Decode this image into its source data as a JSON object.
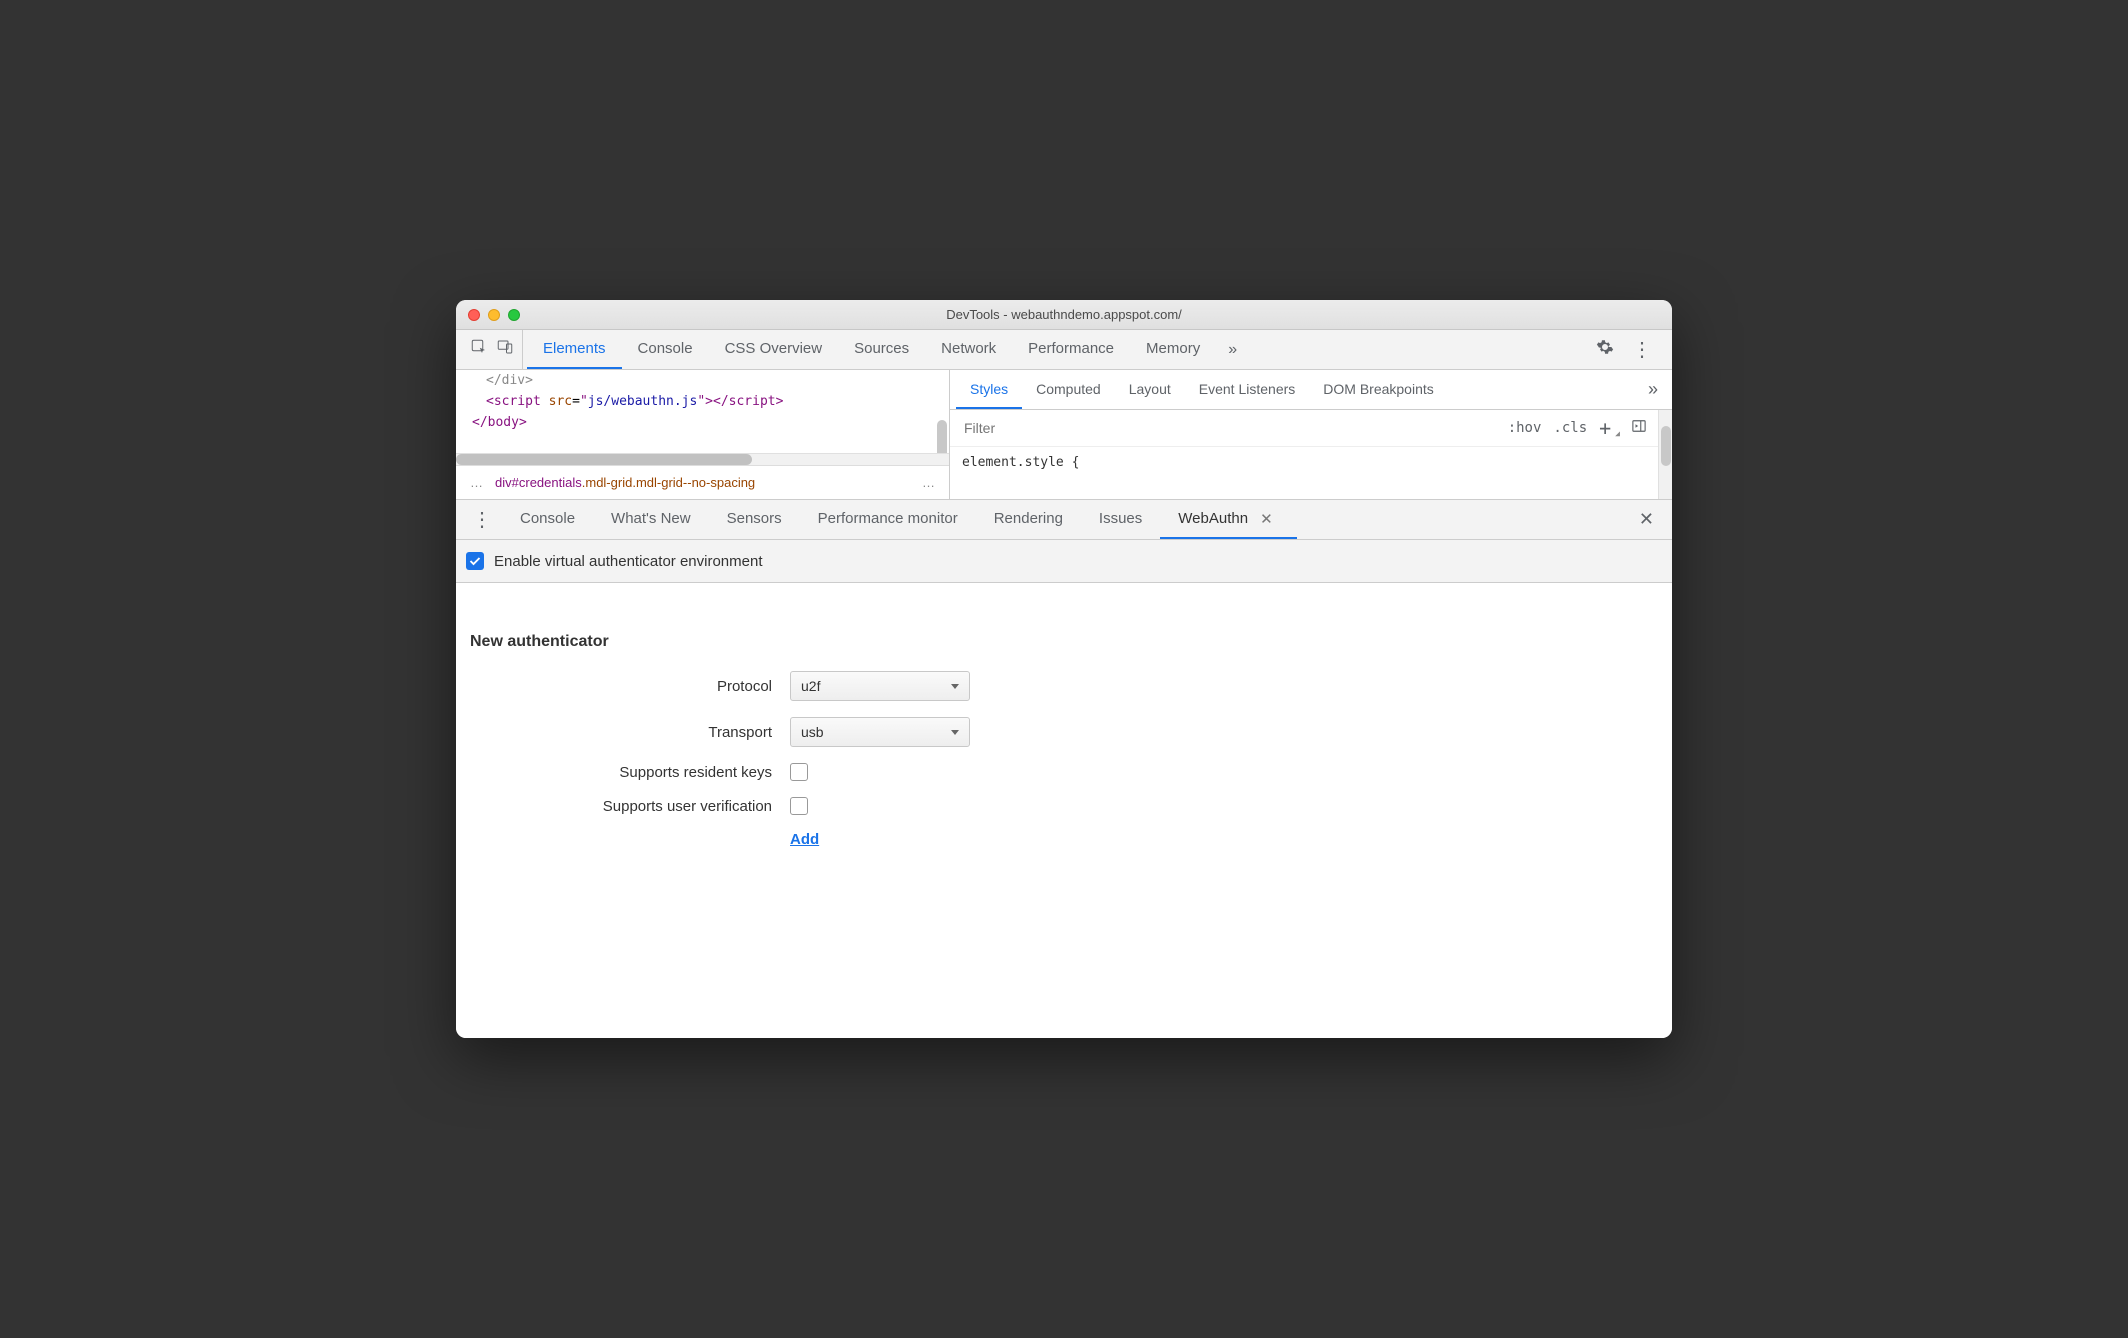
{
  "title": "DevTools - webauthndemo.appspot.com/",
  "top_tabs": [
    "Elements",
    "Console",
    "CSS Overview",
    "Sources",
    "Network",
    "Performance",
    "Memory"
  ],
  "active_top_tab": 0,
  "code": {
    "l1": "</div>",
    "l2_tag1": "<script ",
    "l2_attr": "src",
    "l2_eq": "=",
    "l2_q": "\"",
    "l2_val": "js/webauthn.js",
    "l2_tag2": "></script>",
    "l3": "</body>"
  },
  "breadcrumb": {
    "t1": "div",
    "dot1": "#",
    "t2": "credentials",
    "dot2": ".",
    "t3": "mdl-grid",
    "dot3": ".",
    "t4": "mdl-grid--no-spacing"
  },
  "styles_tabs": [
    "Styles",
    "Computed",
    "Layout",
    "Event Listeners",
    "DOM Breakpoints"
  ],
  "active_styles_tab": 0,
  "filter_placeholder": "Filter",
  "hov": ":hov",
  "cls": ".cls",
  "element_style": "element.style {",
  "drawer_tabs": [
    "Console",
    "What's New",
    "Sensors",
    "Performance monitor",
    "Rendering",
    "Issues",
    "WebAuthn"
  ],
  "active_drawer_tab": 6,
  "enable_label": "Enable virtual authenticator environment",
  "section_heading": "New authenticator",
  "form": {
    "protocol_label": "Protocol",
    "protocol_value": "u2f",
    "transport_label": "Transport",
    "transport_value": "usb",
    "resident_label": "Supports resident keys",
    "userver_label": "Supports user verification",
    "add": "Add"
  }
}
